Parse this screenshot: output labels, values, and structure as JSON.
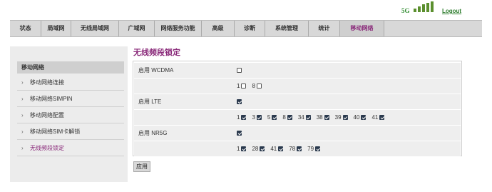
{
  "header": {
    "signal_label": "5G",
    "signal_bars": 5,
    "logout_label": "Logout"
  },
  "nav": {
    "tabs": [
      {
        "label": "状态"
      },
      {
        "label": "局域网"
      },
      {
        "label": "无线局域网"
      },
      {
        "label": "广域网"
      },
      {
        "label": "网络服务功能"
      },
      {
        "label": "高级"
      },
      {
        "label": "诊断"
      },
      {
        "label": "系统管理"
      },
      {
        "label": "统计"
      },
      {
        "label": "移动网络",
        "active": true
      }
    ]
  },
  "sidebar": {
    "title": "移动网络",
    "items": [
      {
        "label": "移动网络连接"
      },
      {
        "label": "移动网络SIMPIN"
      },
      {
        "label": "移动网络配置"
      },
      {
        "label": "移动网络SIM卡解锁"
      },
      {
        "label": "无线频段锁定",
        "active": true
      }
    ]
  },
  "main": {
    "title": "无线频段锁定",
    "sections": [
      {
        "label": "启用 WCDMA",
        "enabled": false,
        "bands": [
          {
            "num": "1",
            "checked": false
          },
          {
            "num": "8",
            "checked": false
          }
        ]
      },
      {
        "label": "启用 LTE",
        "enabled": true,
        "bands": [
          {
            "num": "1",
            "checked": true
          },
          {
            "num": "3",
            "checked": true
          },
          {
            "num": "5",
            "checked": true
          },
          {
            "num": "8",
            "checked": true
          },
          {
            "num": "34",
            "checked": true
          },
          {
            "num": "38",
            "checked": true
          },
          {
            "num": "39",
            "checked": true
          },
          {
            "num": "40",
            "checked": true
          },
          {
            "num": "41",
            "checked": true
          }
        ]
      },
      {
        "label": "启用 NR5G",
        "enabled": true,
        "bands": [
          {
            "num": "1",
            "checked": true
          },
          {
            "num": "28",
            "checked": true
          },
          {
            "num": "41",
            "checked": true
          },
          {
            "num": "78",
            "checked": true
          },
          {
            "num": "79",
            "checked": true
          }
        ]
      }
    ],
    "apply_label": "应用"
  },
  "colors": {
    "accent": "#8a2a7a",
    "signal": "#5b8f2e",
    "nav_bg": "#d8d8d8",
    "checkbox_on": "#2b3a4e"
  }
}
